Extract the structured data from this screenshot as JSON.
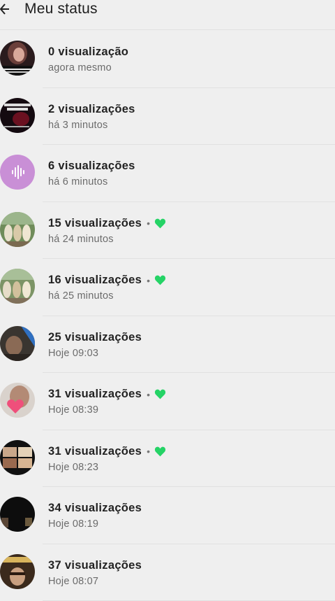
{
  "header": {
    "title": "Meu status"
  },
  "colors": {
    "heart": "#25d366",
    "avatar_audio": "#c98fd6"
  },
  "items": [
    {
      "views": "0 visualização",
      "time": "agora mesmo",
      "liked": false,
      "avatar": "photo-woman"
    },
    {
      "views": "2 visualizações",
      "time": "há 3 minutos",
      "liked": false,
      "avatar": "poster-matheus-moura"
    },
    {
      "views": "6 visualizações",
      "time": "há 6 minutos",
      "liked": false,
      "avatar": "audio-wave-icon"
    },
    {
      "views": "15 visualizações",
      "time": "há 24 minutos",
      "liked": true,
      "avatar": "photo-group"
    },
    {
      "views": "16 visualizações",
      "time": "há 25 minutos",
      "liked": true,
      "avatar": "photo-group"
    },
    {
      "views": "25 visualizações",
      "time": "Hoje 09:03",
      "liked": false,
      "avatar": "photo-street"
    },
    {
      "views": "31 visualizações",
      "time": "Hoje 08:39",
      "liked": true,
      "avatar": "photo-heart"
    },
    {
      "views": "31 visualizações",
      "time": "Hoje 08:23",
      "liked": true,
      "avatar": "photo-collage"
    },
    {
      "views": "34 visualizações",
      "time": "Hoje 08:19",
      "liked": false,
      "avatar": "photo-dark"
    },
    {
      "views": "37 visualizações",
      "time": "Hoje 08:07",
      "liked": false,
      "avatar": "photo-man"
    }
  ]
}
